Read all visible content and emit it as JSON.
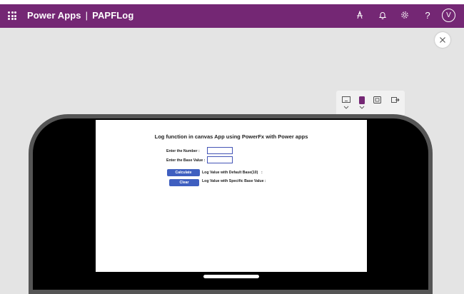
{
  "header": {
    "app_name": "Power Apps",
    "separator": "|",
    "app_title": "PAPFLog",
    "avatar_initial": "V",
    "icons": [
      "waffle-icon",
      "health-monitor-icon",
      "bell-icon",
      "gear-icon",
      "help-icon"
    ],
    "bar_color": "#742774"
  },
  "close": {
    "icon": "close-icon"
  },
  "view_toolbar": {
    "items": [
      "tablet-view-icon",
      "phone-view-icon",
      "fit-view-icon",
      "share-preview-icon"
    ],
    "selected": "phone-view-icon"
  },
  "app": {
    "title": "Log function in canvas App using PowerFx with Power apps",
    "number_label": "Enter the Number :",
    "number_value": "",
    "base_label": "Enter the Base Value :",
    "base_value": "",
    "calculate_label": "Calculate",
    "clear_label": "Clear",
    "default_result_label": "Log Value with Default Base(10)",
    "default_result_colon": ":",
    "specific_result_label": "Log Value with Specific Base Value :",
    "button_color": "#3f5fc0"
  }
}
